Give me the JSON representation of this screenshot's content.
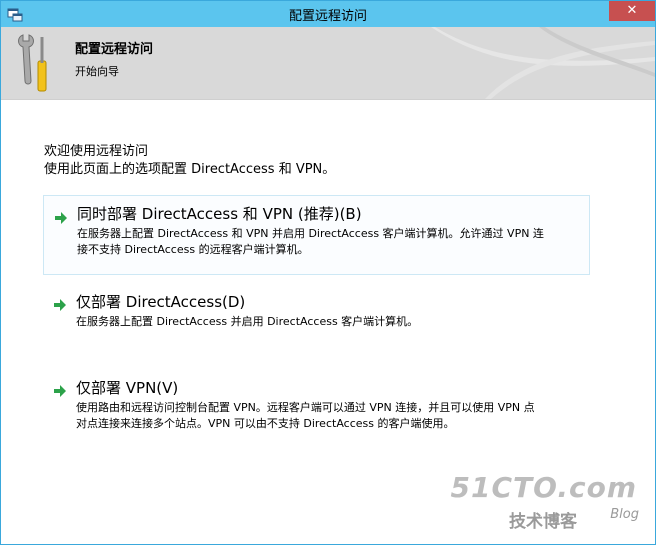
{
  "window": {
    "title": "配置远程访问",
    "close_glyph": "✕"
  },
  "header": {
    "title": "配置远程访问",
    "subtitle": "开始向导"
  },
  "intro": {
    "line1": "欢迎使用远程访问",
    "line2": "使用此页面上的选项配置 DirectAccess 和 VPN。"
  },
  "options": [
    {
      "title": "同时部署 DirectAccess 和 VPN (推荐)(B)",
      "desc_line1": "在服务器上配置 DirectAccess 和 VPN 并启用 DirectAccess 客户端计算机。允许通过 VPN 连",
      "desc_line2": "接不支持 DirectAccess 的远程客户端计算机。"
    },
    {
      "title": "仅部署 DirectAccess(D)",
      "desc_line1": "在服务器上配置 DirectAccess 并启用 DirectAccess 客户端计算机。"
    },
    {
      "title": "仅部署 VPN(V)",
      "desc_line1": "使用路由和远程访问控制台配置 VPN。远程客户端可以通过 VPN 连接，并且可以使用 VPN 点",
      "desc_line2": "对点连接来连接多个站点。VPN 可以由不支持 DirectAccess 的客户端使用。"
    }
  ],
  "watermark": {
    "site": "51CTO.com",
    "label": "技术博客",
    "blog": "Blog"
  },
  "icons": {
    "app": "app-window-icon",
    "header": "wrench-screwdriver-icon",
    "option": "green-arrow-icon"
  },
  "colors": {
    "titlebar": "#5bc5ee",
    "close": "#c75050",
    "header_band": "#d9d9d9",
    "arrow": "#2ca24a",
    "selected_border": "#cde8f5"
  }
}
